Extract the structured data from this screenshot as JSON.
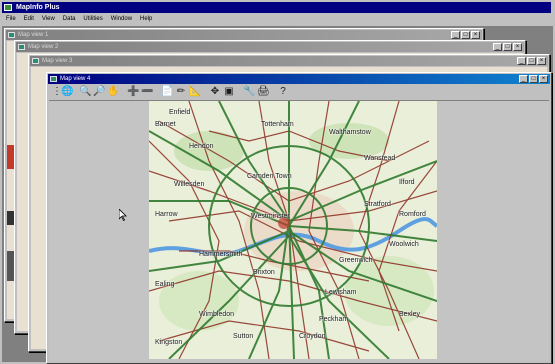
{
  "app": {
    "title": "MapInfo Plus",
    "menu": [
      "File",
      "Edit",
      "View",
      "Data",
      "Utilities",
      "Window",
      "Help"
    ]
  },
  "windows": [
    {
      "title": "Map view 1"
    },
    {
      "title": "Map view 2"
    },
    {
      "title": "Map view 3"
    },
    {
      "title": "Map view 4"
    }
  ],
  "toolbar_tools": [
    "globe-tool",
    "zoom-in-tool",
    "zoom-out-tool",
    "pan-hand-tool",
    "add-tool",
    "remove-tool",
    "document-tool",
    "draw-tool",
    "measure-tool",
    "move-tool",
    "select-area-tool",
    "link-tool",
    "print-tool",
    "help-tool"
  ],
  "map_labels": [
    "Enfield",
    "Tottenham",
    "Walthamstow",
    "Hendon",
    "Wanstead",
    "Ilford",
    "Willesden",
    "Camden Town",
    "Stratford",
    "Westminster",
    "Hammersmith",
    "Greenwich",
    "Woolwich",
    "Brixton",
    "Lewisham",
    "Croydon",
    "Sutton",
    "Wimbledon",
    "Kingston",
    "Bexley",
    "Barnet",
    "Harrow",
    "Romford",
    "Peckham",
    "Ealing"
  ],
  "icons": {
    "window_icon": "map-window-icon",
    "cursor": "arrow-cursor-icon"
  },
  "colors": {
    "roads_major": "#2f7a2f",
    "roads_minor": "#8b2a1f",
    "river": "#5ea0e0",
    "map_bg": "#e9efd8"
  }
}
